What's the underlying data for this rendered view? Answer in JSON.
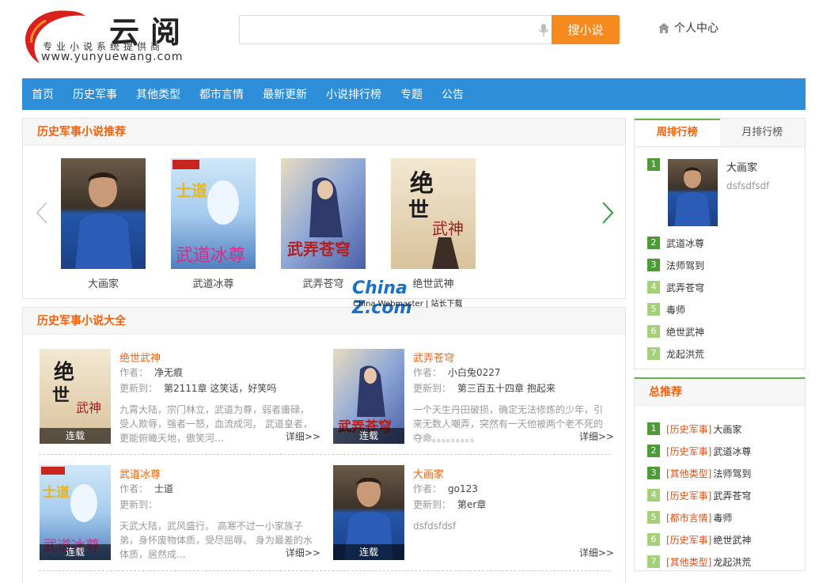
{
  "logo": {
    "title": "云阅",
    "slogan": "专业小说系统提供商",
    "url": "www.yunyuewang.com"
  },
  "search": {
    "placeholder": "",
    "value": "",
    "button": "搜小说"
  },
  "user_center": "个人中心",
  "nav": [
    "首页",
    "历史军事",
    "其他类型",
    "都市言情",
    "最新更新",
    "小说排行榜",
    "专题",
    "公告"
  ],
  "recommend": {
    "title": "历史军事小说推荐",
    "items": [
      {
        "title": "大画家",
        "cover": "photo"
      },
      {
        "title": "武道冰尊",
        "cover": "ice"
      },
      {
        "title": "武弄苍穹",
        "cover": "warrior"
      },
      {
        "title": "绝世武神",
        "cover": "ink"
      }
    ]
  },
  "list": {
    "title": "历史军事小说大全",
    "author_label": "作者：",
    "update_label": "更新到：",
    "more": "详细>>",
    "books": [
      {
        "name": "绝世武神",
        "author": "净无痕",
        "update": "第2111章 这笑话，好笑吗",
        "desc": "九霄大陆，宗门林立，武道为尊，弱者庸碌，受人欺辱，强者一怒，血流成河。 武道皇者，更能俯瞰天地，傲笑河...",
        "status": "连载",
        "cover": "ink"
      },
      {
        "name": "武弄苍穹",
        "author": "小白兔0227",
        "update": "第三百五十四章 抱起来",
        "desc": "一个天生丹田破损，确定无法修炼的少年，引来无数人嘲弄，突然有一天他被两个老不死的夺命。。。。。。。。。",
        "status": "连载",
        "cover": "warrior"
      },
      {
        "name": "武道冰尊",
        "author": "士道",
        "update": "",
        "desc": "天武大陆，武风盛行。 高寒不过一小家族子弟，身怀废物体质，受尽屈辱。 身为最差的水体质，居然成...",
        "status": "连载",
        "cover": "ice"
      },
      {
        "name": "大画家",
        "author": "go123",
        "update": "第er章",
        "desc": "dsfdsfdsf",
        "status": "连载",
        "cover": "photo"
      }
    ]
  },
  "ranking": {
    "tabs": [
      "周排行榜",
      "月排行榜"
    ],
    "top": {
      "num": "1",
      "title": "大画家",
      "desc": "dsfsdfsdf"
    },
    "items": [
      {
        "num": "2",
        "title": "武道冰尊"
      },
      {
        "num": "3",
        "title": "法师驾到"
      },
      {
        "num": "4",
        "title": "武弄苍穹"
      },
      {
        "num": "5",
        "title": "毒师"
      },
      {
        "num": "6",
        "title": "绝世武神"
      },
      {
        "num": "7",
        "title": "龙起洪荒"
      }
    ]
  },
  "total": {
    "title": "总推荐",
    "items": [
      {
        "num": "1",
        "cat": "[历史军事]",
        "title": "大画家"
      },
      {
        "num": "2",
        "cat": "[历史军事]",
        "title": "武道冰尊"
      },
      {
        "num": "3",
        "cat": "[其他类型]",
        "title": "法师驾到"
      },
      {
        "num": "4",
        "cat": "[历史军事]",
        "title": "武弄苍穹"
      },
      {
        "num": "5",
        "cat": "[都市言情]",
        "title": "毒师"
      },
      {
        "num": "6",
        "cat": "[历史军事]",
        "title": "绝世武神"
      },
      {
        "num": "7",
        "cat": "[其他类型]",
        "title": "龙起洪荒"
      }
    ]
  },
  "watermark": {
    "main": "China Z.com",
    "sub": "China Webmaster | 站长下载"
  },
  "colors": {
    "nav": "#2e8ed8",
    "accent": "#f0620c",
    "search_button": "#f58a1f",
    "rank_green": "#4c9b37",
    "rank_light": "#a5d07a"
  }
}
